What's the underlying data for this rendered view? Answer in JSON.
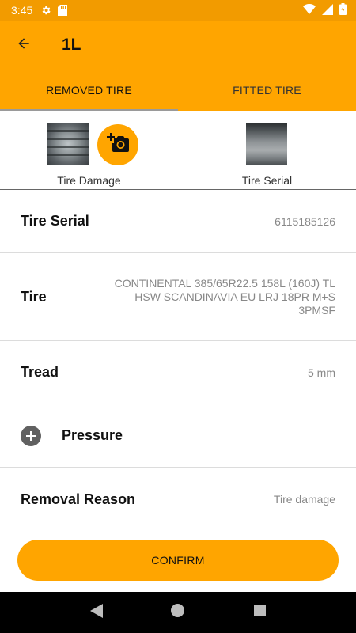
{
  "status_bar": {
    "time": "3:45",
    "icons": [
      "gear-icon",
      "sd-card-icon",
      "wifi-icon",
      "signal-icon",
      "battery-icon"
    ]
  },
  "app_bar": {
    "title": "1L",
    "back_icon": "arrow-left-icon"
  },
  "tabs": [
    {
      "label": "REMOVED TIRE",
      "active": true
    },
    {
      "label": "FITTED TIRE",
      "active": false
    }
  ],
  "photos": {
    "damage_label": "Tire Damage",
    "serial_label": "Tire Serial",
    "camera_icon": "add-photo-icon"
  },
  "details": {
    "tire_serial": {
      "label": "Tire Serial",
      "value": "6115185126"
    },
    "tire": {
      "label": "Tire",
      "value": "CONTINENTAL 385/65R22.5 158L (160J) TL HSW SCANDINAVIA EU LRJ 18PR M+S 3PMSF"
    },
    "tread": {
      "label": "Tread",
      "value": "5 mm"
    },
    "pressure": {
      "label": "Pressure",
      "icon": "plus-circle-icon"
    },
    "removal_reason": {
      "label": "Removal Reason",
      "value": "Tire damage"
    }
  },
  "confirm_label": "CONFIRM",
  "colors": {
    "accent": "#ffa500",
    "status_bar": "#f29b00",
    "label_gray": "#888888"
  }
}
